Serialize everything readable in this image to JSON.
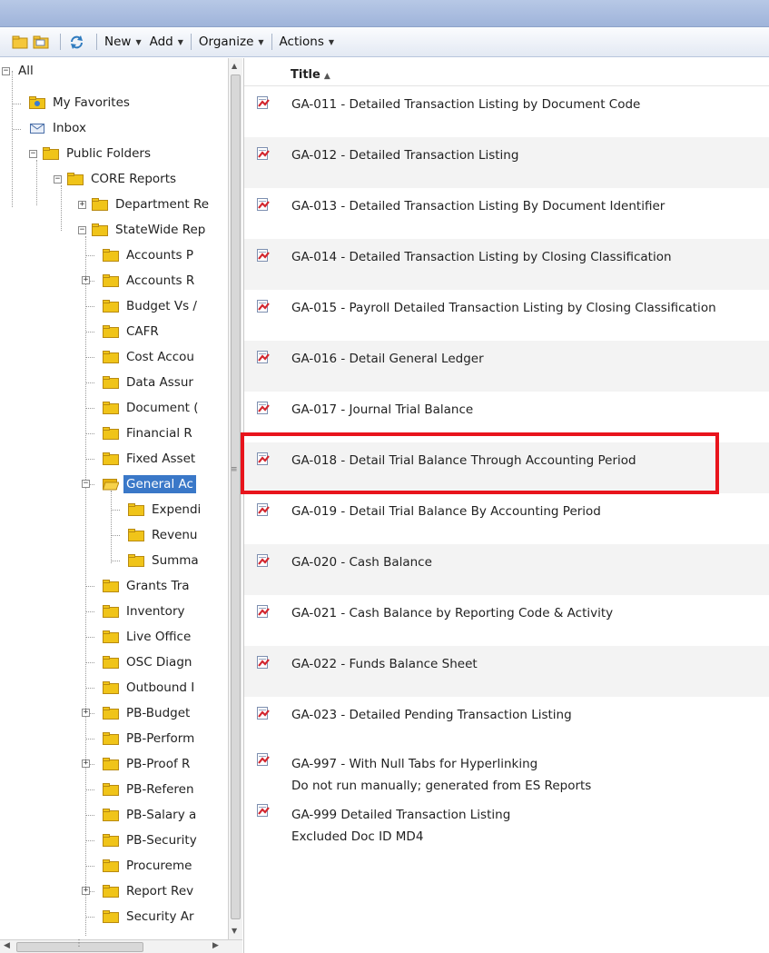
{
  "toolbar": {
    "icons": [
      "folder-view-icon",
      "folder-browse-icon",
      "refresh-icon"
    ],
    "menus": [
      {
        "label": "New"
      },
      {
        "label": "Add"
      },
      {
        "label": "Organize"
      },
      {
        "label": "Actions"
      }
    ]
  },
  "tree": {
    "root": "All",
    "my_favorites": "My Favorites",
    "inbox": "Inbox",
    "public_folders": "Public Folders",
    "core_reports": "CORE Reports",
    "department": "Department Re",
    "statewide": "StateWide Rep",
    "statewide_children": [
      "Accounts P",
      "Accounts R",
      "Budget Vs /",
      "CAFR",
      "Cost Accou",
      "Data Assur",
      "Document (",
      "Financial R",
      "Fixed Asset",
      "General Ac",
      "Expendi",
      "Revenu",
      "Summa",
      "Grants Tra",
      "Inventory",
      "Live Office",
      "OSC Diagn",
      "Outbound I",
      "PB-Budget",
      "PB-Perform",
      "PB-Proof R",
      "PB-Referen",
      "PB-Salary a",
      "PB-Security",
      "Procureme",
      "Report Rev",
      "Security Ar"
    ],
    "selected": "General Ac"
  },
  "list": {
    "header": "Title",
    "rows": [
      {
        "title": "GA-011 - Detailed Transaction Listing by Document Code"
      },
      {
        "title": "GA-012 - Detailed Transaction Listing"
      },
      {
        "title": "GA-013 - Detailed Transaction Listing By Document Identifier"
      },
      {
        "title": "GA-014 - Detailed Transaction Listing by Closing Classification"
      },
      {
        "title": "GA-015 - Payroll Detailed Transaction Listing by Closing Classification"
      },
      {
        "title": "GA-016 - Detail General Ledger"
      },
      {
        "title": "GA-017 - Journal Trial Balance"
      },
      {
        "title": "GA-018 - Detail Trial Balance Through Accounting Period"
      },
      {
        "title": "GA-019 - Detail Trial Balance By Accounting Period"
      },
      {
        "title": "GA-020 - Cash Balance"
      },
      {
        "title": "GA-021 - Cash Balance by Reporting Code & Activity"
      },
      {
        "title": "GA-022 - Funds Balance Sheet"
      },
      {
        "title": "GA-023 - Detailed Pending Transaction Listing"
      },
      {
        "title": "GA-997 - With Null Tabs for Hyperlinking",
        "description": "Do not run manually; generated from ES Reports"
      },
      {
        "title": "GA-999 Detailed Transaction Listing",
        "description": "Excluded Doc ID MD4"
      }
    ]
  },
  "colors": {
    "selection": "#3a78c8",
    "highlight": "#e8141c",
    "folder": "#f0c419"
  }
}
